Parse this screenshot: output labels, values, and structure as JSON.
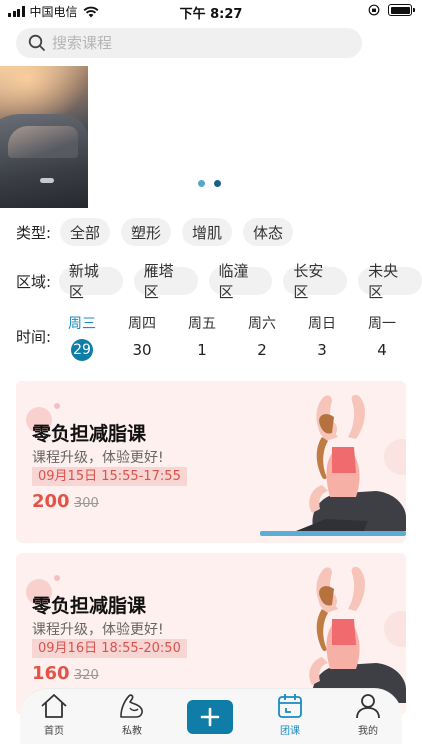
{
  "status_bar": {
    "carrier": "中国电信",
    "time": "下午 8:27"
  },
  "search": {
    "placeholder": "搜索课程"
  },
  "filters": {
    "type": {
      "label": "类型:",
      "options": [
        "全部",
        "塑形",
        "增肌",
        "体态"
      ]
    },
    "area": {
      "label": "区域:",
      "options": [
        "新城区",
        "雁塔区",
        "临潼区",
        "长安区",
        "未央区"
      ]
    }
  },
  "schedule": {
    "label": "时间:",
    "days": [
      {
        "weekday": "周三",
        "date": "29",
        "selected": true
      },
      {
        "weekday": "周四",
        "date": "30"
      },
      {
        "weekday": "周五",
        "date": "1"
      },
      {
        "weekday": "周六",
        "date": "2"
      },
      {
        "weekday": "周日",
        "date": "3"
      },
      {
        "weekday": "周一",
        "date": "4"
      }
    ]
  },
  "courses": [
    {
      "title": "零负担减脂课",
      "subtitle": "课程升级，体验更好!",
      "time": "09月15日 15:55-17:55",
      "price": "200",
      "original_price": "300"
    },
    {
      "title": "零负担减脂课",
      "subtitle": "课程升级，体验更好!",
      "time": "09月16日 18:55-20:50",
      "price": "160",
      "original_price": "320"
    }
  ],
  "tab_bar": {
    "items": [
      {
        "label": "首页",
        "icon": "home-icon"
      },
      {
        "label": "私教",
        "icon": "muscle-arm-icon"
      },
      {
        "label": "",
        "icon": "plus-icon"
      },
      {
        "label": "团课",
        "icon": "calendar-icon",
        "active": true
      },
      {
        "label": "我的",
        "icon": "user-icon"
      }
    ]
  },
  "colors": {
    "accent": "#0f7da8",
    "price": "#e2534a",
    "card_bg": "#fdf0ee"
  }
}
